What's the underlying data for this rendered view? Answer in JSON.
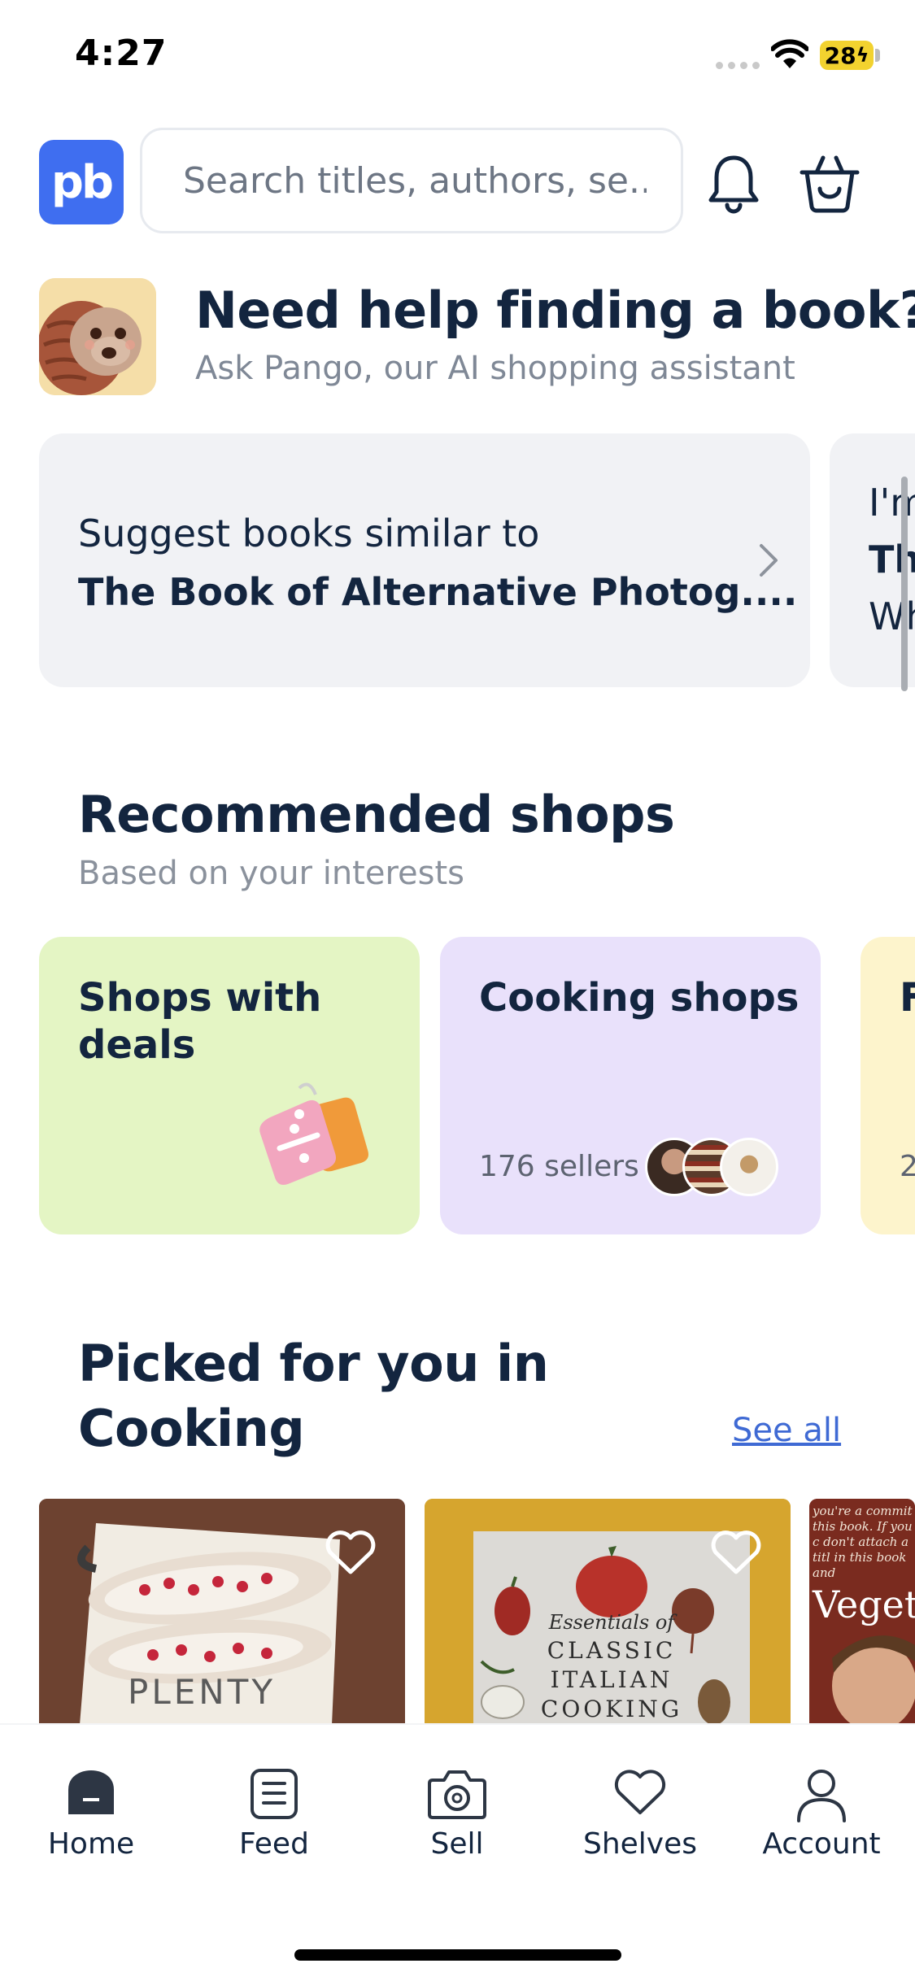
{
  "status_bar": {
    "time": "4:27",
    "battery": "28"
  },
  "header": {
    "logo_text": "pb",
    "search_placeholder": "Search titles, authors, se..."
  },
  "pango": {
    "title": "Need help finding a book?",
    "subtitle": "Ask Pango, our AI shopping assistant",
    "prompts": [
      {
        "line1": "Suggest books similar to",
        "line2": "The Book of Alternative Photog...."
      },
      {
        "line1": "I'm",
        "line2": "The",
        "line3": "Wh"
      }
    ]
  },
  "recommended": {
    "title": "Recommended shops",
    "subtitle": "Based on your interests",
    "cards": [
      {
        "name": "Shops with deals",
        "color": "#e4f5c4"
      },
      {
        "name": "Cooking shops",
        "count": "176 sellers",
        "color": "#e9e1fb"
      },
      {
        "name": "F",
        "count": "2",
        "color": "#fdf4cc"
      }
    ]
  },
  "picked": {
    "title_line1": "Picked for you in",
    "title_line2": "Cooking",
    "see_all": "See all",
    "books": [
      {
        "cover_text": "PLENTY"
      },
      {
        "cover_text": "Essentials of CLASSIC ITALIAN COOKING",
        "c1": "Essentials of",
        "c2": "CLASSIC",
        "c3": "ITALIAN",
        "c4": "COOKING"
      },
      {
        "cover_text": "Veget",
        "blurb": "you're a commit this book. If you c don't attach a titl in this book and"
      }
    ]
  },
  "tabs": [
    {
      "label": "Home",
      "icon": "home-icon"
    },
    {
      "label": "Feed",
      "icon": "feed-icon"
    },
    {
      "label": "Sell",
      "icon": "camera-icon"
    },
    {
      "label": "Shelves",
      "icon": "heart-icon"
    },
    {
      "label": "Account",
      "icon": "account-icon"
    }
  ],
  "colors": {
    "accent": "#3f6ef0",
    "text_dark": "#13253f",
    "link": "#3f6ad4"
  }
}
